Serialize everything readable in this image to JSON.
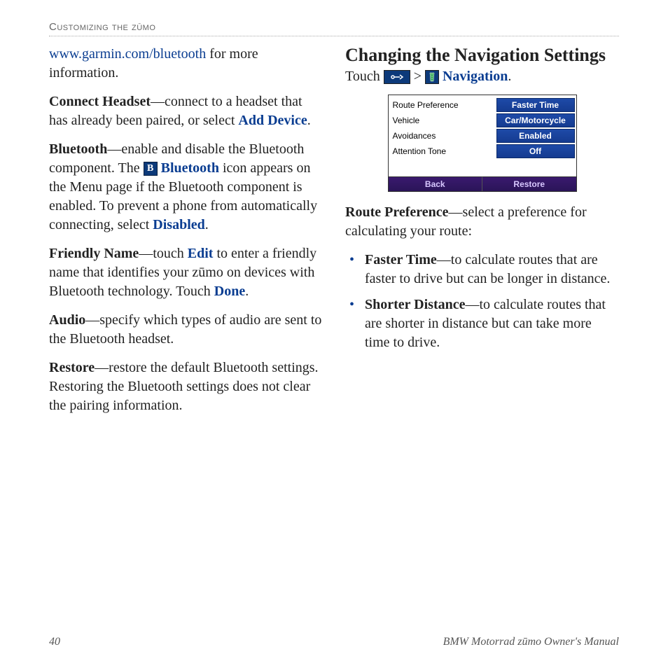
{
  "header": {
    "section_title": "Customizing the zūmo"
  },
  "left": {
    "link_url": "www.garmin.com/bluetooth",
    "link_tail": " for more information.",
    "p_connect_headset_term": "Connect Headset",
    "p_connect_headset_body": "—connect to a headset that has already been paired, or select ",
    "p_connect_headset_action": "Add Device",
    "p_connect_headset_end": ".",
    "p_bt_term": "Bluetooth",
    "p_bt_body1": "—enable and disable the Bluetooth component. The ",
    "p_bt_iconlabel": "Bluetooth",
    "p_bt_body2": " icon appears on the Menu page if the Bluetooth component is enabled. To prevent a phone from automatically connecting, select ",
    "p_bt_action": "Disabled",
    "p_bt_end": ".",
    "p_fn_term": "Friendly Name",
    "p_fn_body1": "—touch ",
    "p_fn_edit": "Edit",
    "p_fn_body2": " to enter a friendly name that identifies your zūmo on devices with Bluetooth technology. Touch ",
    "p_fn_done": "Done",
    "p_fn_end": ".",
    "p_audio_term": "Audio",
    "p_audio_body": "—specify which types of audio are sent to the Bluetooth headset.",
    "p_restore_term": "Restore",
    "p_restore_body": "—restore the default Bluetooth settings. Restoring the Bluetooth settings does not clear the pairing information."
  },
  "right": {
    "heading": "Changing the Navigation Settings",
    "touch_prefix": "Touch ",
    "touch_sep": " > ",
    "touch_nav": "Navigation",
    "touch_end": ".",
    "screenshot": {
      "rows": [
        {
          "label": "Route Preference",
          "value": "Faster Time"
        },
        {
          "label": "Vehicle",
          "value": "Car/Motorcycle"
        },
        {
          "label": "Avoidances",
          "value": "Enabled"
        },
        {
          "label": "Attention Tone",
          "value": "Off"
        }
      ],
      "back": "Back",
      "restore": "Restore"
    },
    "route_pref_term": "Route Preference",
    "route_pref_body": "—select a preference for calculating your route:",
    "bullets": [
      {
        "term": "Faster Time",
        "body": "—to calculate routes that are faster to drive but can be longer in distance."
      },
      {
        "term": "Shorter Distance",
        "body": "—to calculate routes that are shorter in distance but can take more time to drive."
      }
    ]
  },
  "footer": {
    "page_num": "40",
    "manual_title": "BMW Motorrad zūmo Owner's Manual"
  },
  "icons": {
    "wrench": "⚙",
    "road": "▞",
    "bluetooth": "B"
  }
}
